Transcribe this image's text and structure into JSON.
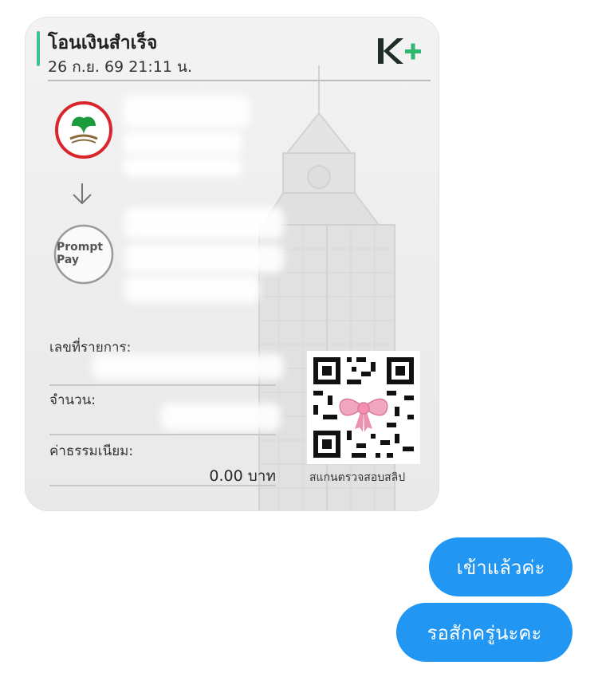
{
  "slip": {
    "title": "โอนเงินสำเร็จ",
    "datetime": "26 ก.ย. 69  21:11 น.",
    "brand_logo": "K+",
    "sender_bank_icon": "kbank-logo",
    "recipient_icon": "promptpay-logo",
    "promptpay_text_1": "Prompt",
    "promptpay_text_2": "Pay",
    "transaction_no_label": "เลขที่รายการ:",
    "amount_label": "จำนวน:",
    "fee_label": "ค่าธรรมเนียม:",
    "fee_value": "0.00 บาท",
    "qr_caption": "สแกนตรวจสอบสลิป"
  },
  "chat": {
    "messages": [
      {
        "text": "เข้าแล้วค่ะ",
        "side": "right"
      },
      {
        "text": "รอสักครู่นะคะ",
        "side": "right"
      }
    ]
  },
  "colors": {
    "bubble": "#2196f3",
    "accent": "#3fc28e",
    "kbank_green": "#1a9b3c",
    "kbank_red": "#d8262c"
  }
}
